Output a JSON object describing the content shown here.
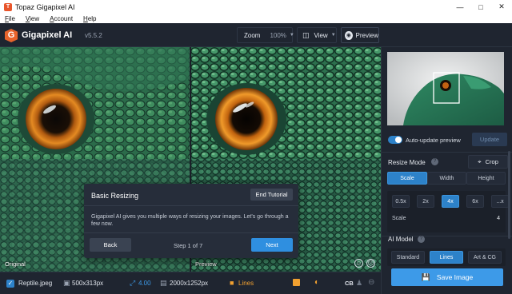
{
  "window": {
    "title": "Topaz Gigapixel AI"
  },
  "menu": [
    "File",
    "View",
    "Account",
    "Help"
  ],
  "toolbar": {
    "app_name": "Gigapixel AI",
    "version": "v5.5.2",
    "zoom_label": "Zoom",
    "zoom_value": "100%",
    "view_label": "View",
    "preview_label": "Preview"
  },
  "viewer": {
    "original_label": "Original",
    "preview_label": "Preview"
  },
  "tutorial": {
    "title": "Basic Resizing",
    "end_label": "End Tutorial",
    "body": "Gigapixel AI gives you multiple ways of resizing your images. Let's go through a few now.",
    "back_label": "Back",
    "step_text": "Step 1 of 7",
    "next_label": "Next"
  },
  "sidebar": {
    "auto_update_label": "Auto-update preview",
    "update_label": "Update",
    "resize_mode_label": "Resize Mode",
    "crop_label": "Crop",
    "resize_tabs": [
      "Scale",
      "Width",
      "Height"
    ],
    "scale_options": [
      "0.5x",
      "2x",
      "4x",
      "6x",
      "...x"
    ],
    "scale_label": "Scale",
    "scale_value": "4",
    "ai_model_label": "AI Model",
    "models": [
      "Standard",
      "Lines",
      "Art & CG"
    ],
    "save_label": "Save Image"
  },
  "status": {
    "file_name": "Reptile.jpeg",
    "source_size": "500x313px",
    "scale": "4.00",
    "output_size": "2000x1252px",
    "model": "Lines",
    "cb": "CB"
  },
  "colors": {
    "accent": "#2d82c9",
    "save": "#3d9ae8",
    "next": "#2f8fe0",
    "logo": "#e8642c",
    "model_orange": "#f0a030"
  }
}
